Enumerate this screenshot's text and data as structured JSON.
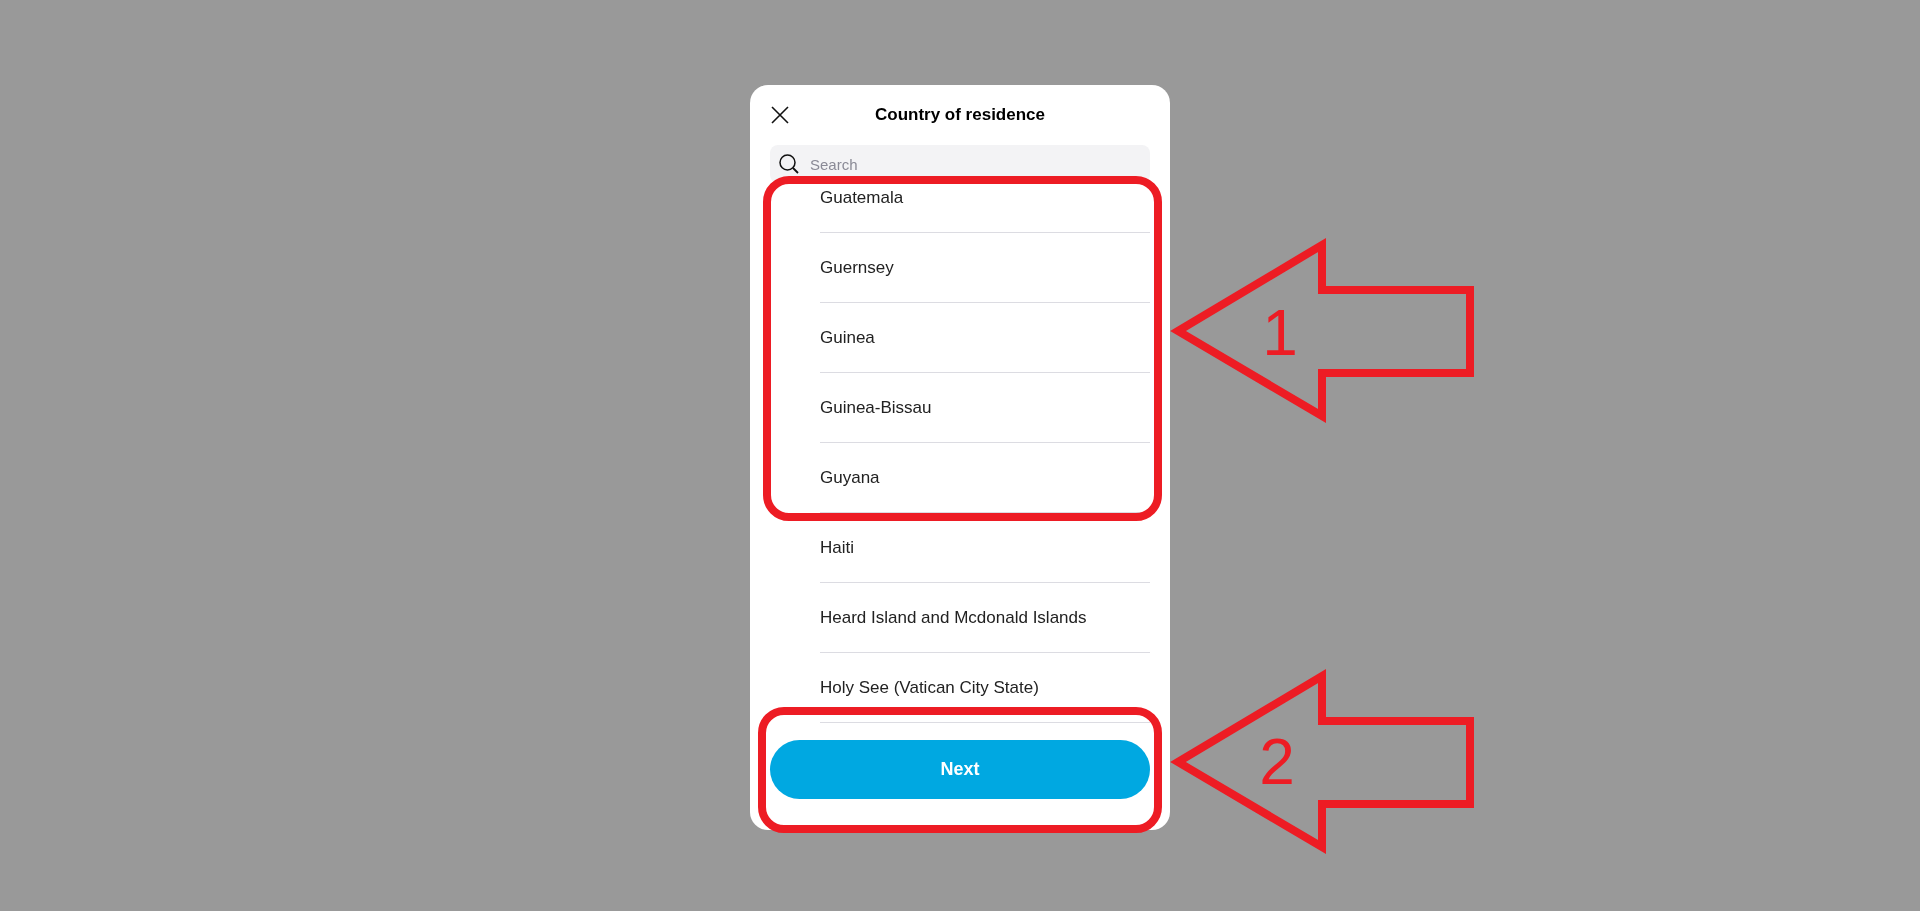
{
  "dialog": {
    "title": "Country of residence"
  },
  "search": {
    "placeholder": "Search"
  },
  "countries": [
    {
      "name": "Guatemala"
    },
    {
      "name": "Guernsey"
    },
    {
      "name": "Guinea"
    },
    {
      "name": "Guinea-Bissau"
    },
    {
      "name": "Guyana"
    },
    {
      "name": "Haiti"
    },
    {
      "name": "Heard Island and Mcdonald Islands"
    },
    {
      "name": "Holy See (Vatican City State)"
    }
  ],
  "next_button": {
    "label": "Next"
  },
  "annotations": [
    {
      "number": "1"
    },
    {
      "number": "2"
    }
  ]
}
